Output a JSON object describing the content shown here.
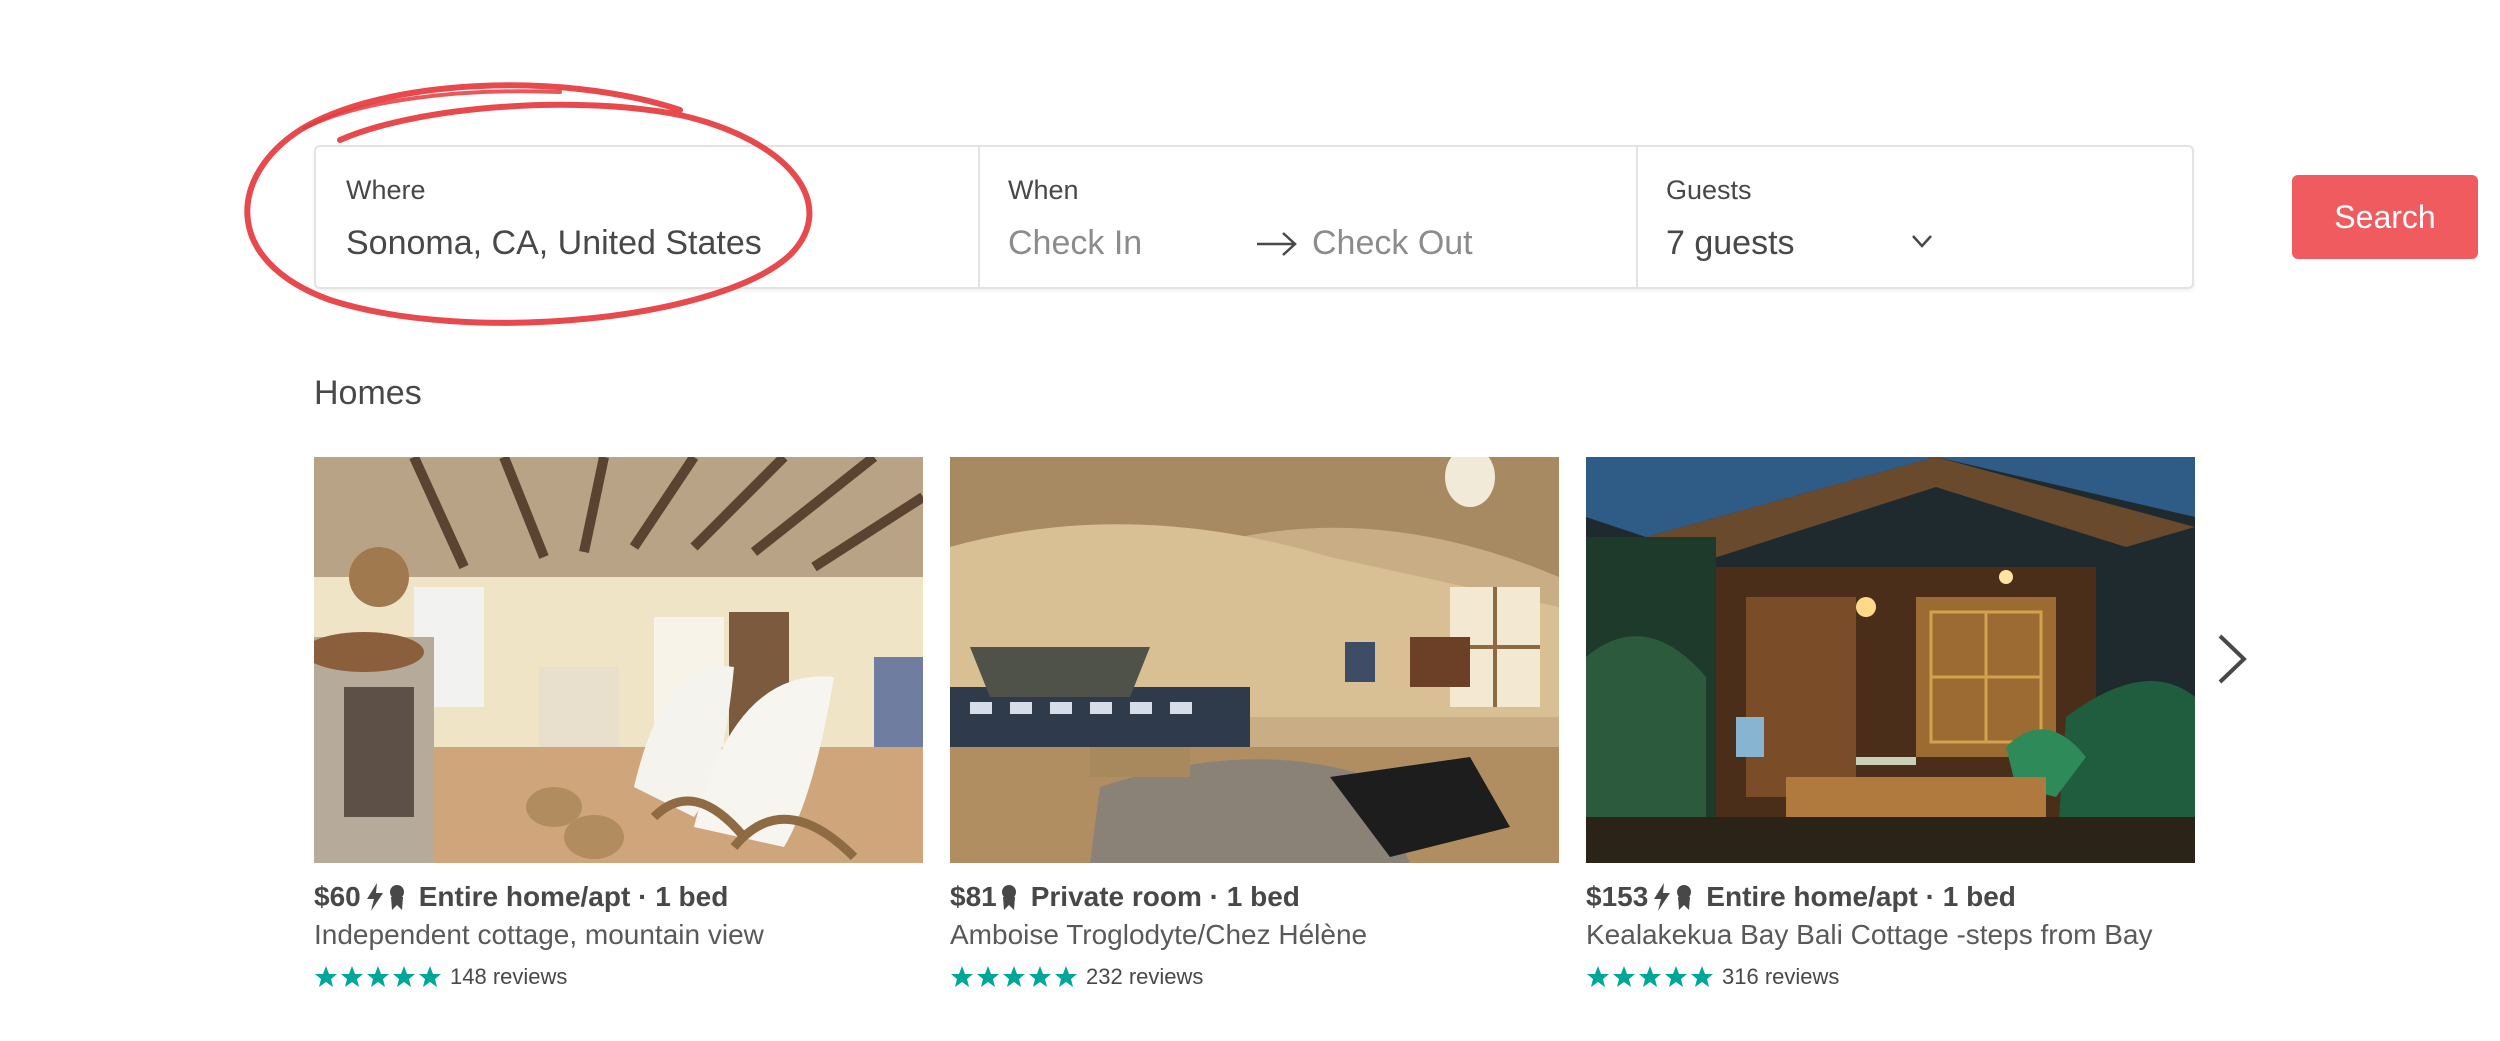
{
  "search": {
    "where_label": "Where",
    "where_value": "Sonoma, CA, United States",
    "when_label": "When",
    "check_in": "Check In",
    "check_out": "Check Out",
    "guests_label": "Guests",
    "guests_value": "7 guests",
    "search_button": "Search"
  },
  "section_title": "Homes",
  "colors": {
    "accent": "#f05b60",
    "star": "#00a699",
    "annotation": "#e5393e"
  },
  "listings": [
    {
      "price": "$60",
      "badges": [
        "instant-book-icon",
        "superhost-icon"
      ],
      "room_type": "Entire home/apt · 1 bed",
      "title": "Independent cottage, mountain view",
      "rating_stars": 5,
      "reviews": "148 reviews"
    },
    {
      "price": "$81",
      "badges": [
        "superhost-icon"
      ],
      "room_type": "Private room · 1 bed",
      "title": "Amboise Troglodyte/Chez Hélène",
      "rating_stars": 5,
      "reviews": "232 reviews"
    },
    {
      "price": "$153",
      "badges": [
        "instant-book-icon",
        "superhost-icon"
      ],
      "room_type": "Entire home/apt · 1 bed",
      "title": "Kealakekua Bay Bali Cottage -steps from Bay",
      "rating_stars": 5,
      "reviews": "316 reviews"
    }
  ],
  "icons": {
    "arrow": "right-arrow-icon",
    "guests_dropdown": "chevron-down-icon",
    "carousel_next": "chevron-right-icon"
  }
}
